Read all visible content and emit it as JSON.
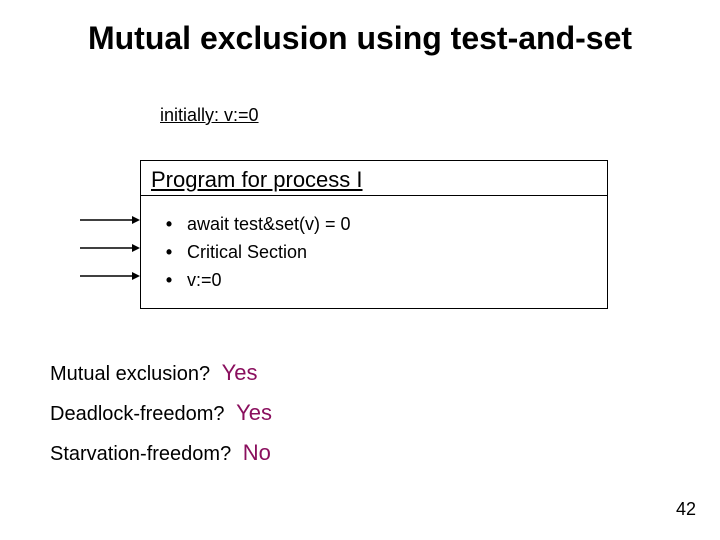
{
  "title": "Mutual exclusion using test-and-set",
  "initially": "initially: v:=0",
  "program": {
    "heading": "Program for process I",
    "bullets": [
      "await test&set(v) = 0",
      "Critical Section",
      "v:=0"
    ]
  },
  "qa": [
    {
      "q": "Mutual exclusion?",
      "a": "Yes"
    },
    {
      "q": "Deadlock-freedom?",
      "a": "Yes"
    },
    {
      "q": "Starvation-freedom?",
      "a": "No"
    }
  ],
  "page_number": "42"
}
